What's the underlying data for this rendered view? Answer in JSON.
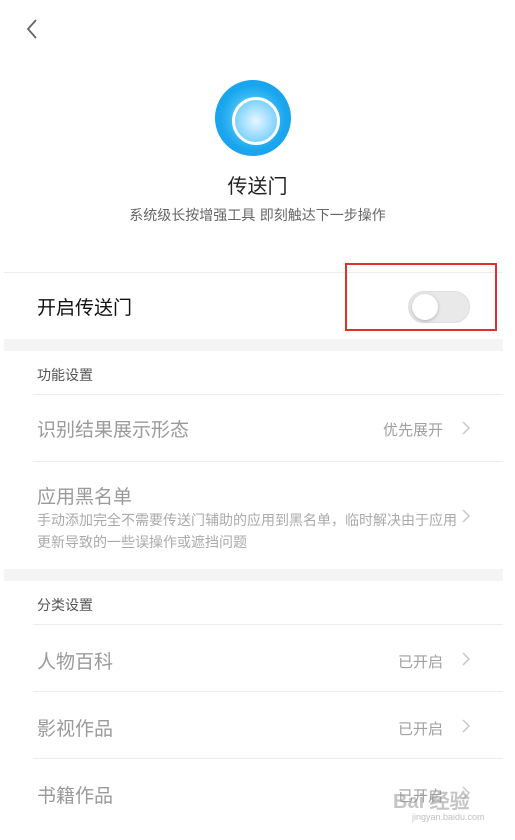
{
  "header": {
    "back_icon": "chevron-left-icon"
  },
  "app": {
    "title": "传送门",
    "subtitle": "系统级长按增强工具 即刻触达下一步操作",
    "logo_icon": "portal-logo-icon",
    "accent_color": "#1aa6ee"
  },
  "toggle": {
    "label": "开启传送门",
    "enabled": false
  },
  "highlight_color": "#e1302c",
  "function_settings": {
    "header": "功能设置",
    "items": [
      {
        "label": "识别结果展示形态",
        "value": "优先展开"
      },
      {
        "label": "应用黑名单",
        "desc": "手动添加完全不需要传送门辅助的应用到黑名单，临时解决由于应用更新导致的一些误操作或遮挡问题"
      }
    ]
  },
  "category_settings": {
    "header": "分类设置",
    "items": [
      {
        "label": "人物百科",
        "value": "已开启"
      },
      {
        "label": "影视作品",
        "value": "已开启"
      },
      {
        "label": "书籍作品",
        "value": "已开启"
      }
    ]
  },
  "watermark": {
    "main": "Bai 经验",
    "sub": "jingyan.baidu.com"
  }
}
